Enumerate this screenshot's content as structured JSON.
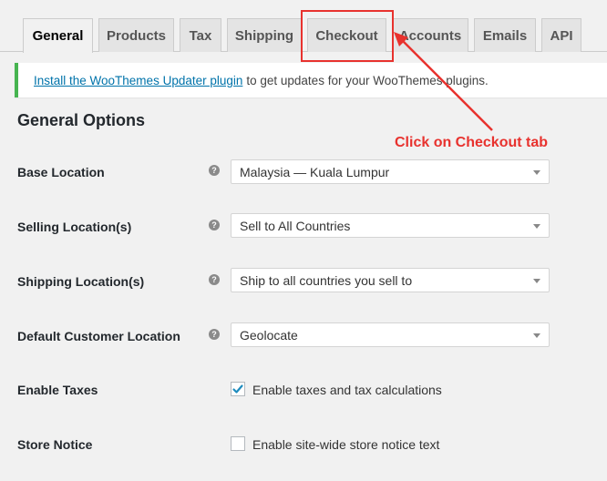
{
  "tabs": [
    {
      "label": "General",
      "active": true
    },
    {
      "label": "Products",
      "active": false
    },
    {
      "label": "Tax",
      "active": false
    },
    {
      "label": "Shipping",
      "active": false
    },
    {
      "label": "Checkout",
      "active": false
    },
    {
      "label": "Accounts",
      "active": false
    },
    {
      "label": "Emails",
      "active": false
    },
    {
      "label": "API",
      "active": false
    }
  ],
  "notice": {
    "link_text": "Install the WooThemes Updater plugin",
    "text": "to get updates for your WooThemes plugins."
  },
  "section_title": "General Options",
  "settings": {
    "base_location": {
      "label": "Base Location",
      "value": "Malaysia — Kuala Lumpur"
    },
    "selling_locations": {
      "label": "Selling Location(s)",
      "value": "Sell to All Countries"
    },
    "shipping_locations": {
      "label": "Shipping Location(s)",
      "value": "Ship to all countries you sell to"
    },
    "default_customer_location": {
      "label": "Default Customer Location",
      "value": "Geolocate"
    },
    "enable_taxes": {
      "label": "Enable Taxes",
      "checkbox_label": "Enable taxes and tax calculations",
      "checked": true
    },
    "store_notice": {
      "label": "Store Notice",
      "checkbox_label": "Enable site-wide store notice text",
      "checked": false
    }
  },
  "help_icon_glyph": "?",
  "icons": {
    "help": "question-circle-icon",
    "caret": "chevron-down-icon",
    "check": "checkmark-icon"
  },
  "annotation": {
    "text": "Click on Checkout tab",
    "color": "#e8322e"
  },
  "colors": {
    "link": "#0073aa",
    "notice_border": "#46b450",
    "checkbox_check": "#1e8cbe"
  }
}
